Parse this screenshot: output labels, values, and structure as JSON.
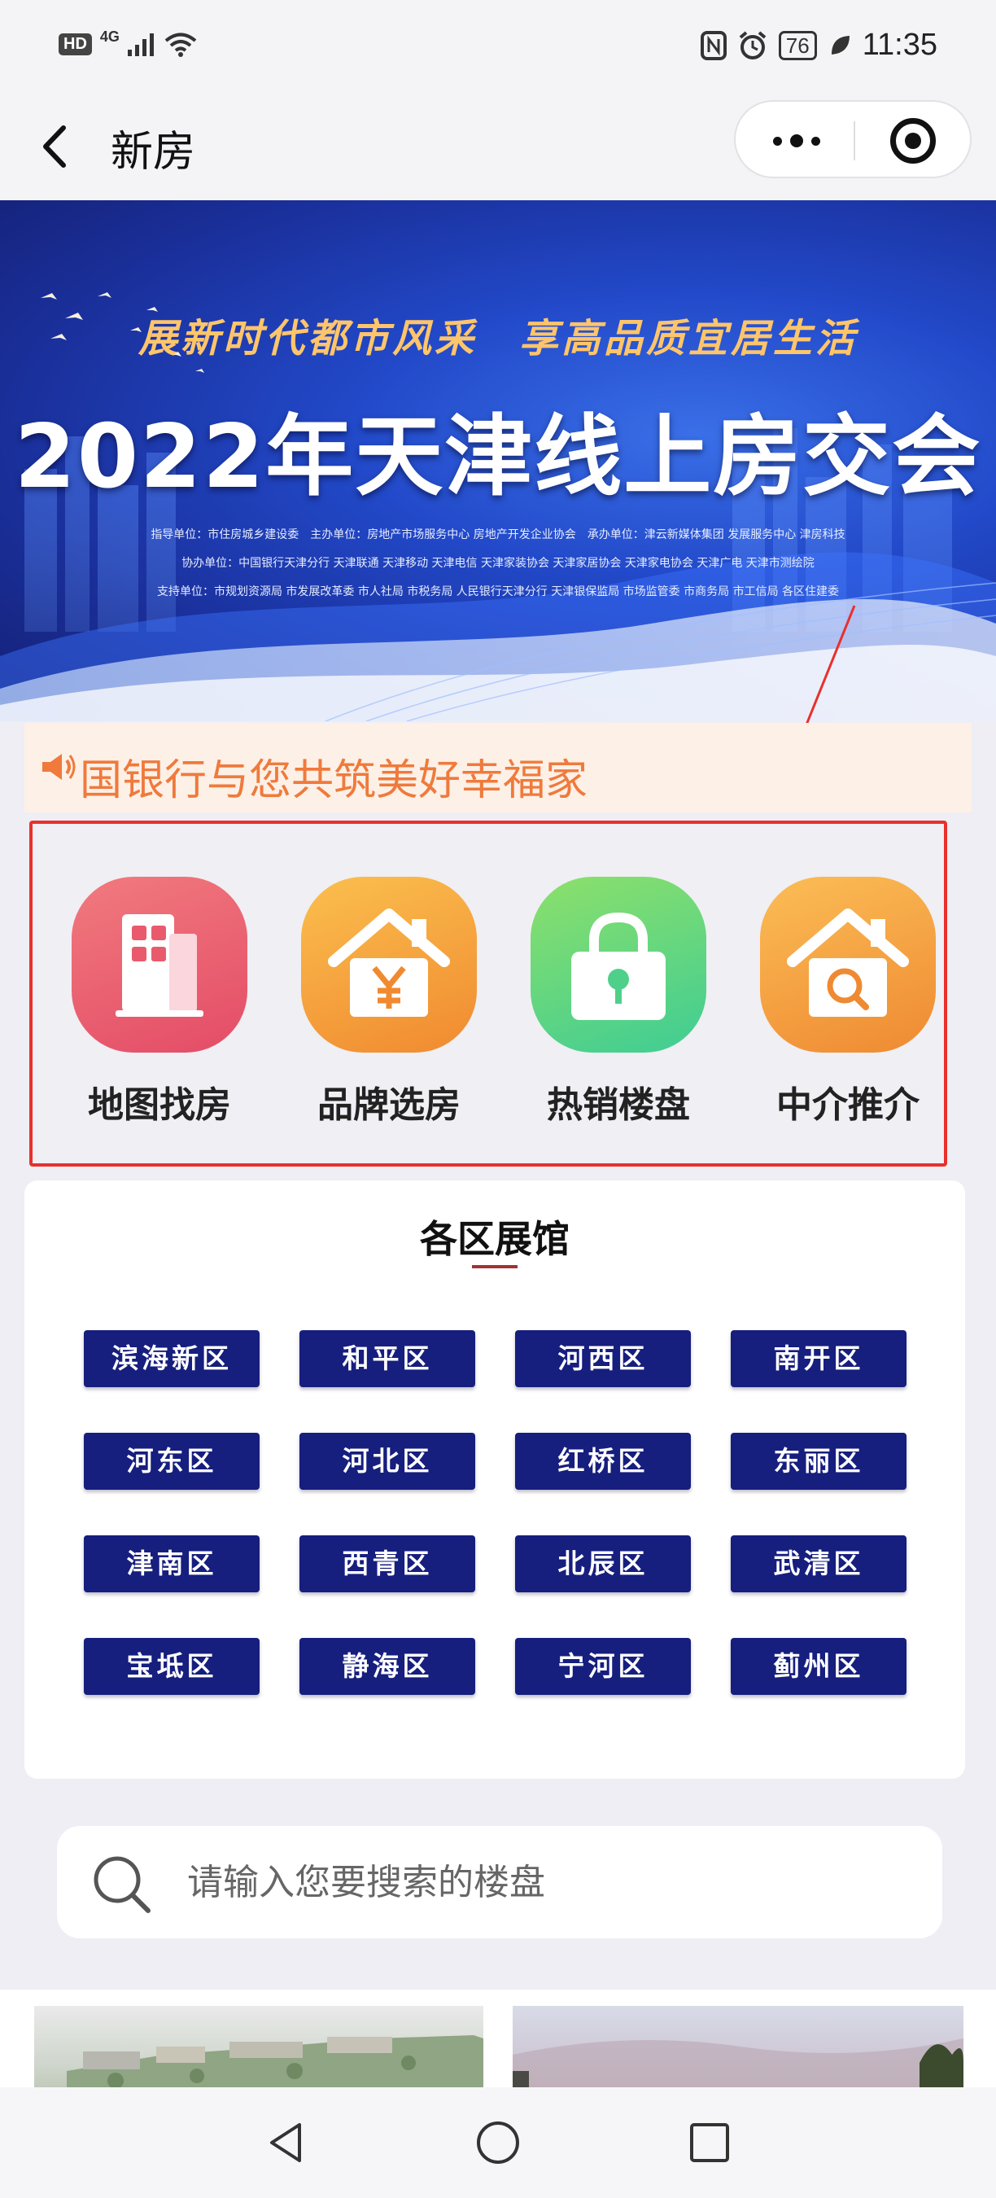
{
  "status_bar": {
    "hd": "HD",
    "network": "4G",
    "battery": "76",
    "time": "11:35"
  },
  "nav": {
    "title": "新房"
  },
  "banner": {
    "slogan": "展新时代都市风采　享高品质宜居生活",
    "title": "2022年天津线上房交会",
    "lines": [
      "指导单位：市住房城乡建设委　主办单位：房地产市场服务中心 房地产开发企业协会　承办单位：津云新媒体集团 发展服务中心 津房科技",
      "协办单位：中国银行天津分行 天津联通 天津移动 天津电信 天津家装协会 天津家居协会 天津家电协会 天津广电 天津市测绘院",
      "支持单位：市规划资源局 市发展改革委 市人社局 市税务局 人民银行天津分行 天津银保监局 市场监管委 市商务局 市工信局 各区住建委"
    ]
  },
  "notice": {
    "text": "国银行与您共筑美好幸福家"
  },
  "quick_menu": [
    {
      "label": "地图找房",
      "icon": "building-icon",
      "color": "#ec5d6e"
    },
    {
      "label": "品牌选房",
      "icon": "house-yen-icon",
      "color": "#f59a36"
    },
    {
      "label": "热销楼盘",
      "icon": "lock-bag-icon",
      "color": "#4fd08a"
    },
    {
      "label": "中介推介",
      "icon": "house-search-icon",
      "color": "#f29a3a"
    }
  ],
  "districts": {
    "title": "各区展馆",
    "items": [
      "滨海新区",
      "和平区",
      "河西区",
      "南开区",
      "河东区",
      "河北区",
      "红桥区",
      "东丽区",
      "津南区",
      "西青区",
      "北辰区",
      "武清区",
      "宝坻区",
      "静海区",
      "宁河区",
      "蓟州区"
    ]
  },
  "search": {
    "placeholder": "请输入您要搜索的楼盘"
  },
  "colors": {
    "district_button": "#161e7e",
    "highlight_box": "#e8302c",
    "notice_text": "#ef7a3c"
  }
}
